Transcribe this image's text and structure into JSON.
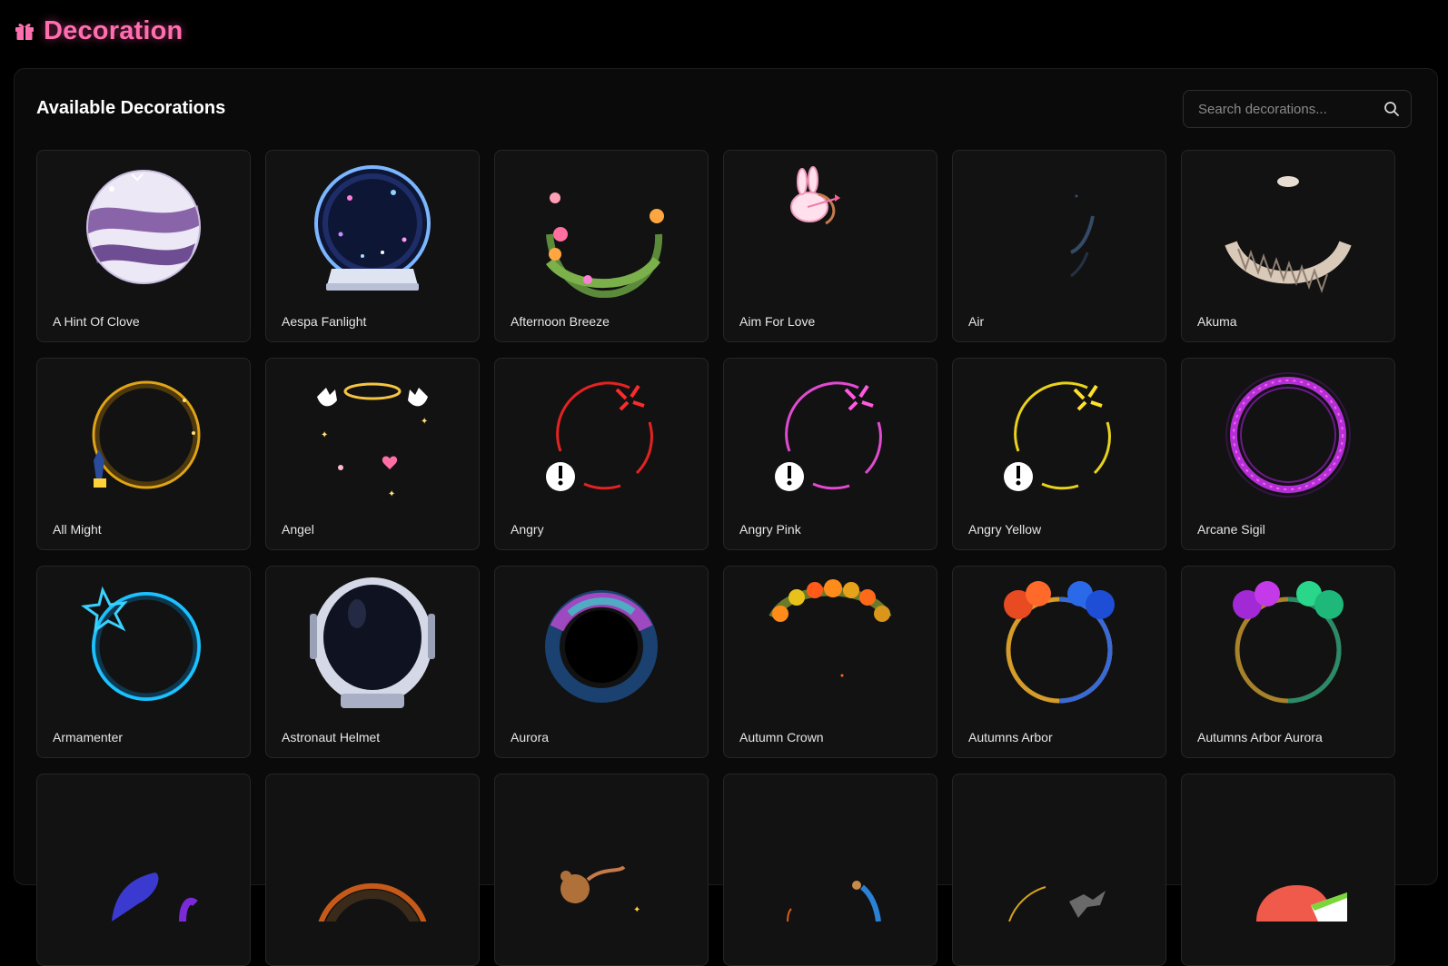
{
  "header": {
    "title": "Decoration",
    "icon": "gift-icon",
    "accent": "#ff6fb0"
  },
  "panel": {
    "title": "Available Decorations",
    "search": {
      "placeholder": "Search decorations...",
      "value": ""
    }
  },
  "decorations": [
    {
      "name": "A Hint Of Clove"
    },
    {
      "name": "Aespa Fanlight"
    },
    {
      "name": "Afternoon Breeze"
    },
    {
      "name": "Aim For Love"
    },
    {
      "name": "Air"
    },
    {
      "name": "Akuma"
    },
    {
      "name": "All Might"
    },
    {
      "name": "Angel"
    },
    {
      "name": "Angry"
    },
    {
      "name": "Angry Pink"
    },
    {
      "name": "Angry Yellow"
    },
    {
      "name": "Arcane Sigil"
    },
    {
      "name": "Armamenter"
    },
    {
      "name": "Astronaut Helmet"
    },
    {
      "name": "Aurora"
    },
    {
      "name": "Autumn Crown"
    },
    {
      "name": "Autumns Arbor"
    },
    {
      "name": "Autumns Arbor Aurora"
    },
    {
      "name": ""
    },
    {
      "name": ""
    },
    {
      "name": ""
    },
    {
      "name": ""
    },
    {
      "name": ""
    },
    {
      "name": ""
    }
  ]
}
